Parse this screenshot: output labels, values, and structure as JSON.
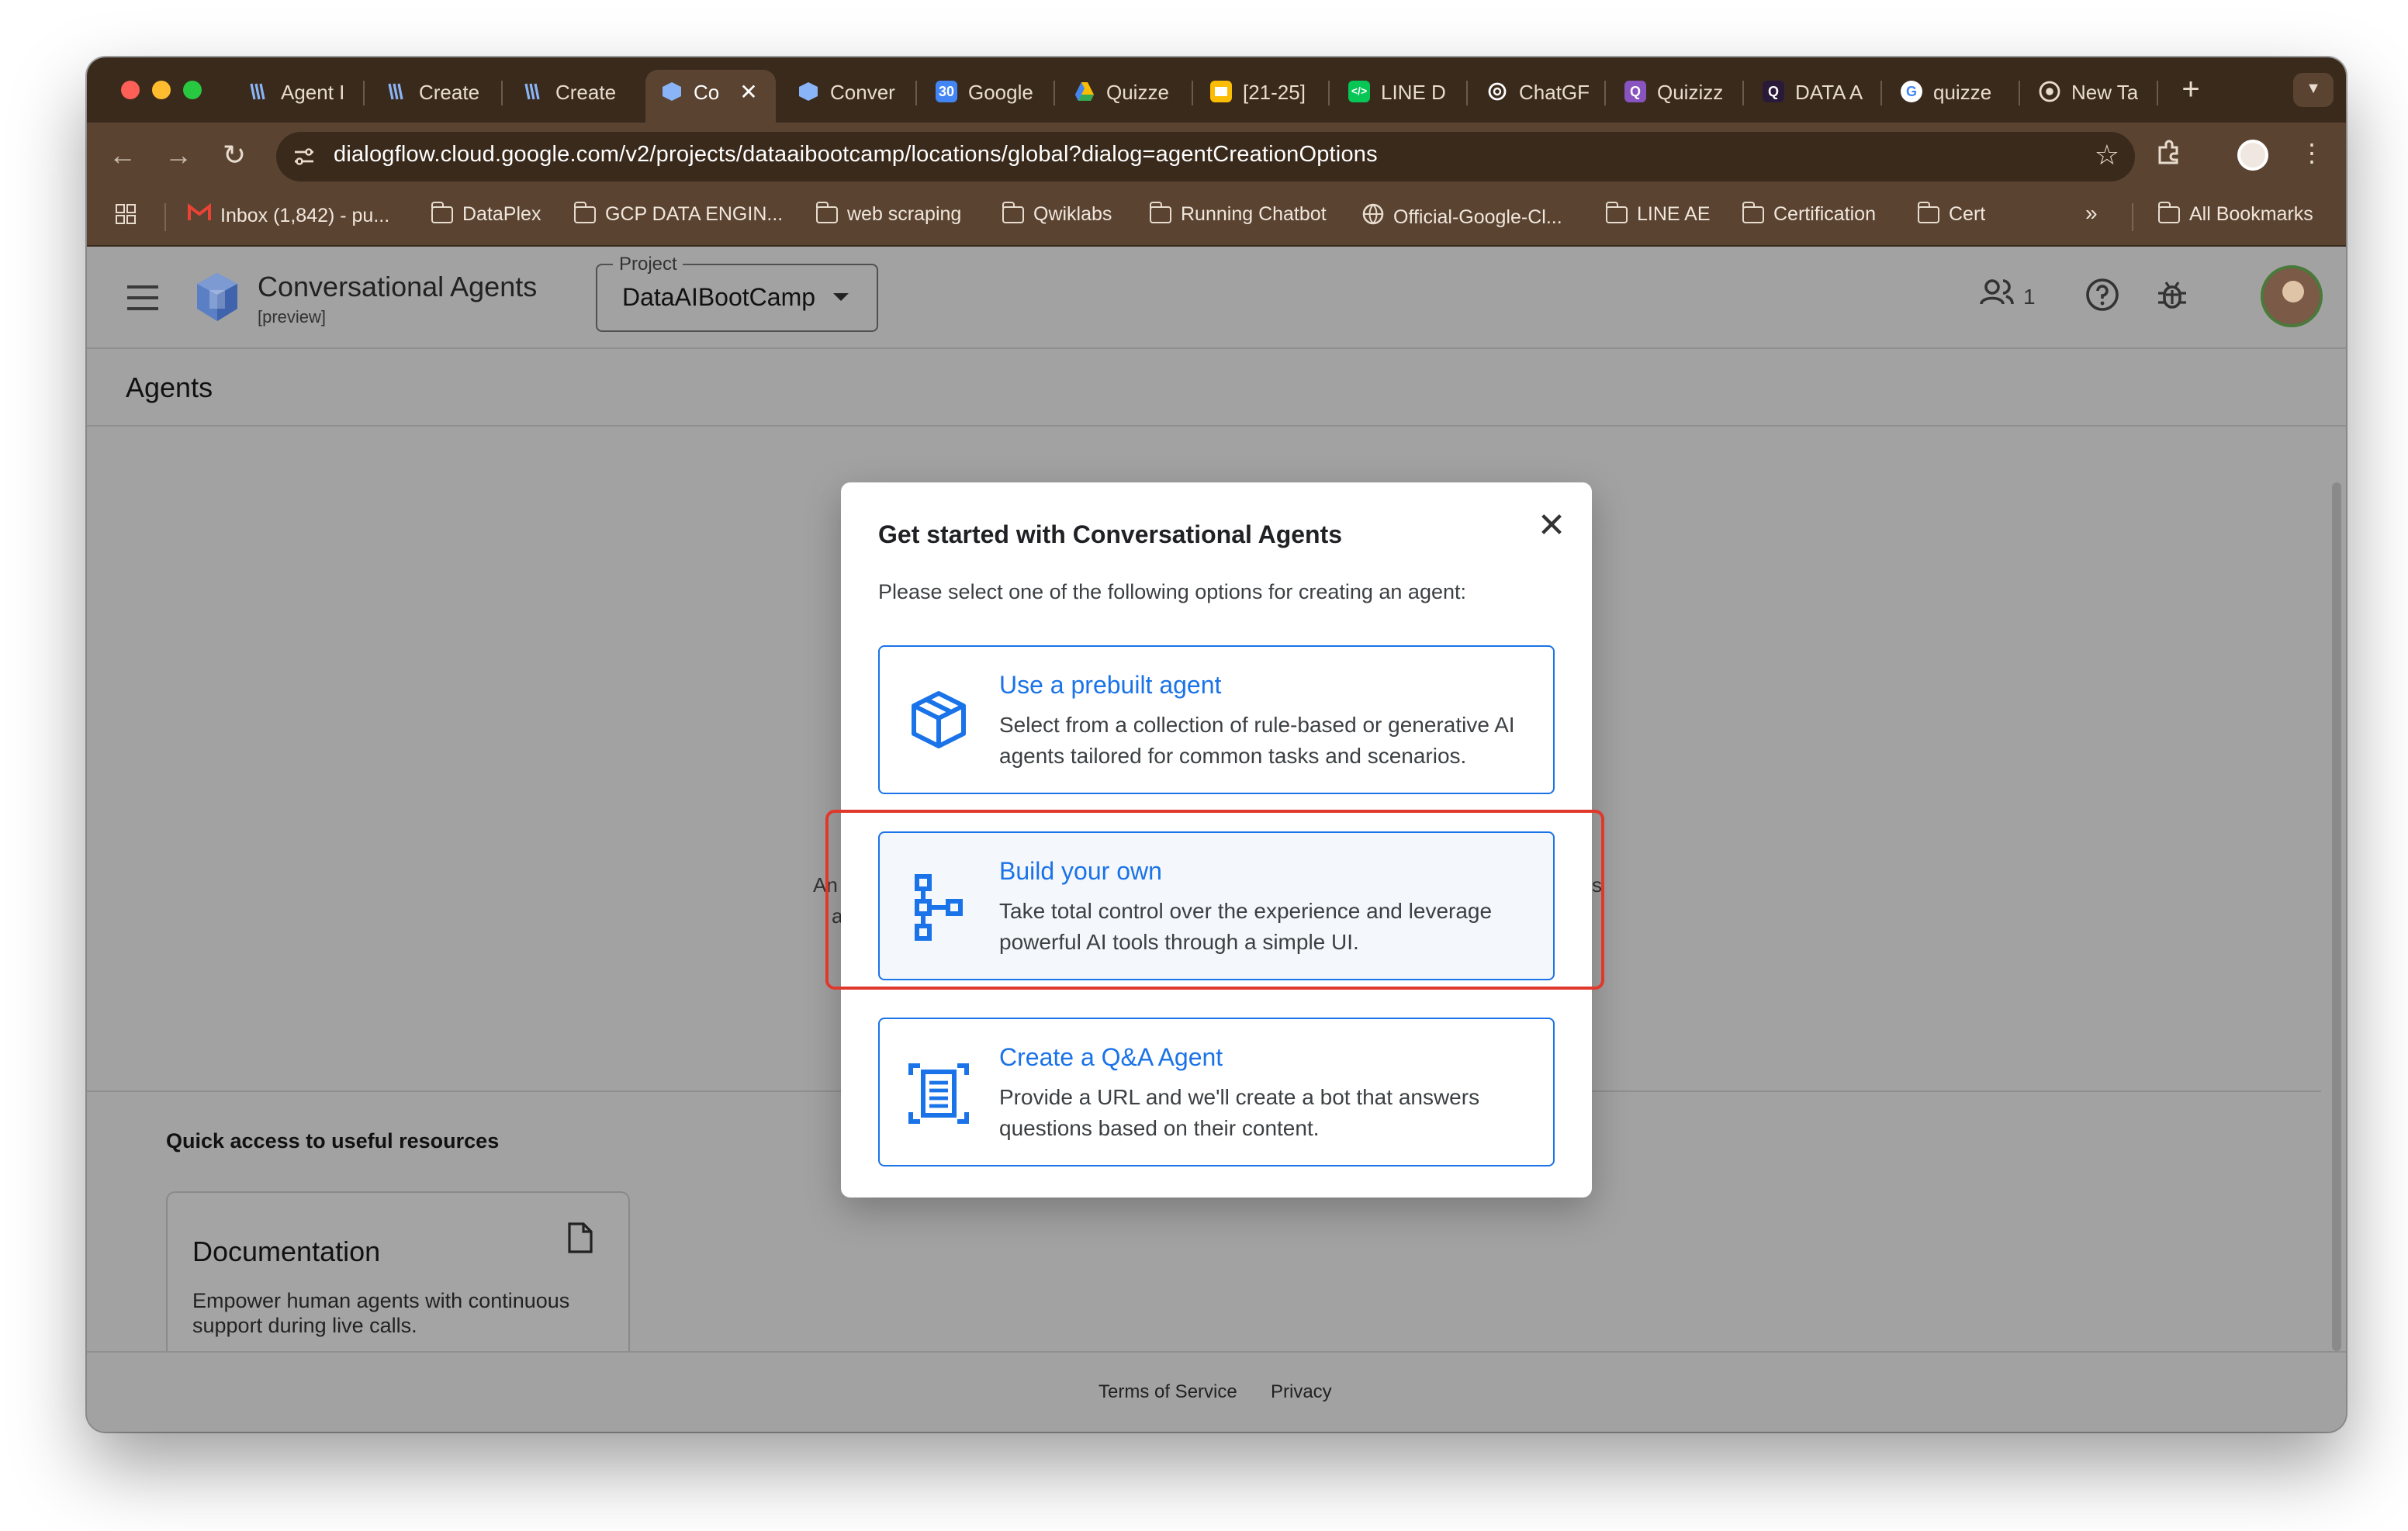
{
  "tabs": [
    {
      "label": "Agent I",
      "icon": "dialogflow-icon",
      "color": "#8ab4f8"
    },
    {
      "label": "Create",
      "icon": "dialogflow-icon",
      "color": "#8ab4f8"
    },
    {
      "label": "Create",
      "icon": "dialogflow-icon",
      "color": "#8ab4f8"
    },
    {
      "label": "Co",
      "icon": "conversational-agents-icon",
      "color": "#8ab4f8",
      "active": true
    },
    {
      "label": "Conver",
      "icon": "conversational-agents-icon",
      "color": "#8ab4f8"
    },
    {
      "label": "Google",
      "icon": "calendar-icon",
      "color": "#4285f4"
    },
    {
      "label": "Quizze",
      "icon": "drive-icon",
      "color": "#fbbc04"
    },
    {
      "label": "[21-25]",
      "icon": "slides-icon",
      "color": "#fbbc04"
    },
    {
      "label": "LINE D",
      "icon": "line-icon",
      "color": "#06c755"
    },
    {
      "label": "ChatGF",
      "icon": "chatgpt-icon",
      "color": "#ffffff"
    },
    {
      "label": "Quizizz",
      "icon": "quizizz-icon",
      "color": "#8854c0"
    },
    {
      "label": "DATA A",
      "icon": "quizizz-icon",
      "color": "#8854c0"
    },
    {
      "label": "quizze",
      "icon": "google-icon",
      "color": "#ffffff"
    },
    {
      "label": "New Ta",
      "icon": "chrome-icon",
      "color": "#ffffff"
    }
  ],
  "toolbar": {
    "url": "dialogflow.cloud.google.com/v2/projects/dataaibootcamp/locations/global?dialog=agentCreationOptions"
  },
  "bookmarks": [
    {
      "label": "Inbox (1,842) - pu...",
      "icon": "gmail-icon"
    },
    {
      "label": "DataPlex",
      "icon": "folder-icon"
    },
    {
      "label": "GCP DATA ENGIN...",
      "icon": "folder-icon"
    },
    {
      "label": "web scraping",
      "icon": "folder-icon"
    },
    {
      "label": "Qwiklabs",
      "icon": "folder-icon"
    },
    {
      "label": "Running Chatbot",
      "icon": "folder-icon"
    },
    {
      "label": "Official-Google-Cl...",
      "icon": "globe-icon"
    },
    {
      "label": "LINE AE",
      "icon": "folder-icon"
    },
    {
      "label": "Certification",
      "icon": "folder-icon"
    },
    {
      "label": "Cert",
      "icon": "folder-icon"
    }
  ],
  "bookmarks_more": "»",
  "all_bookmarks": "All Bookmarks",
  "app": {
    "title": "Conversational Agents",
    "subtitle": "[preview]",
    "project_label": "Project",
    "project_value": "DataAIBootCamp",
    "people_count": "1",
    "page_title": "Agents"
  },
  "background": {
    "partial_left_1": "An",
    "partial_left_2": "a",
    "partial_right": "s",
    "quick_access_title": "Quick access to useful resources",
    "doc_card_title": "Documentation",
    "doc_card_desc": "Empower human agents with continuous support during live calls."
  },
  "footer": {
    "terms": "Terms of Service",
    "privacy": "Privacy"
  },
  "dialog": {
    "title": "Get started with Conversational Agents",
    "description": "Please select one of the following options for creating an agent:",
    "options": [
      {
        "title": "Use a prebuilt agent",
        "desc": "Select from a collection of rule-based or generative AI agents tailored for common tasks and scenarios.",
        "icon": "cube-icon"
      },
      {
        "title": "Build your own",
        "desc": "Take total control over the experience and leverage powerful AI tools through a simple UI.",
        "icon": "flow-tree-icon"
      },
      {
        "title": "Create a Q&A Agent",
        "desc": "Provide a URL and we'll create a bot that answers questions based on their content.",
        "icon": "document-scan-icon"
      }
    ]
  },
  "colors": {
    "accent": "#1a73e8",
    "highlight_box": "#e0382b",
    "tab_strip": "#3a2a1c",
    "toolbar": "#5a4331"
  }
}
